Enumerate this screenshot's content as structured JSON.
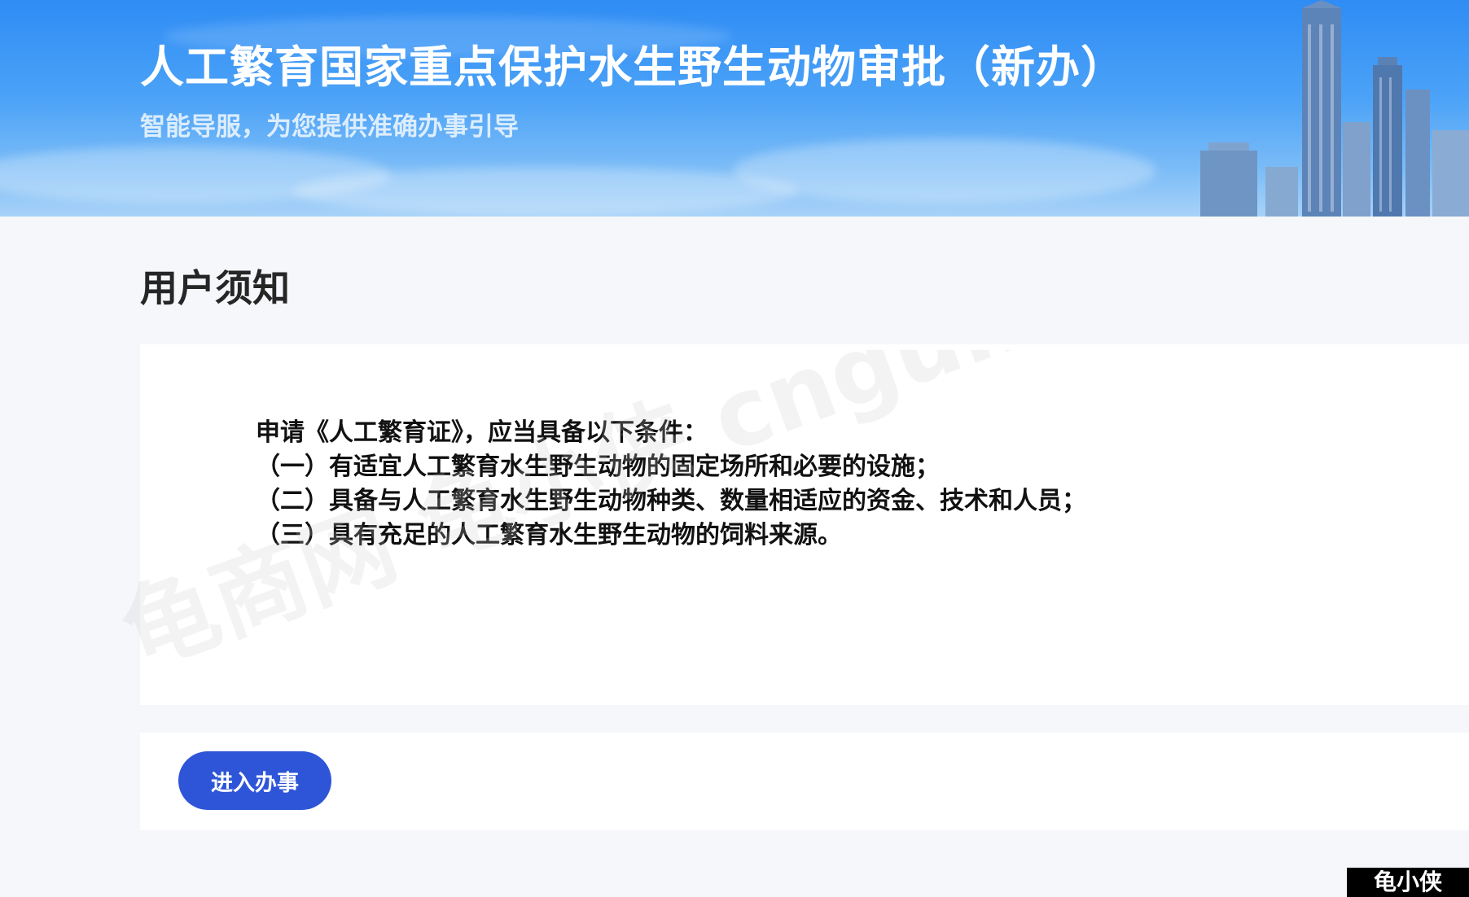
{
  "header": {
    "title": "人工繁育国家重点保护水生野生动物审批（新办）",
    "subtitle": "智能导服，为您提供准确办事引导"
  },
  "notice": {
    "heading": "用户须知",
    "intro": "申请《人工繁育证》，应当具备以下条件：",
    "conditions": [
      "（一）有适宜人工繁育水生野生动物的固定场所和必要的设施；",
      "（二）具备与人工繁育水生野生动物种类、数量相适应的资金、技术和人员；",
      "（三）具有充足的人工繁育水生野生动物的饲料来源。"
    ]
  },
  "actions": {
    "enter_label": "进入办事"
  },
  "watermark": {
    "text": "龟商网 龟小侠 cnguibie.com",
    "corner": "龟小侠"
  },
  "colors": {
    "banner_blue": "#2e8cf4",
    "button_blue": "#2e55d8",
    "page_bg": "#f5f7fa"
  }
}
